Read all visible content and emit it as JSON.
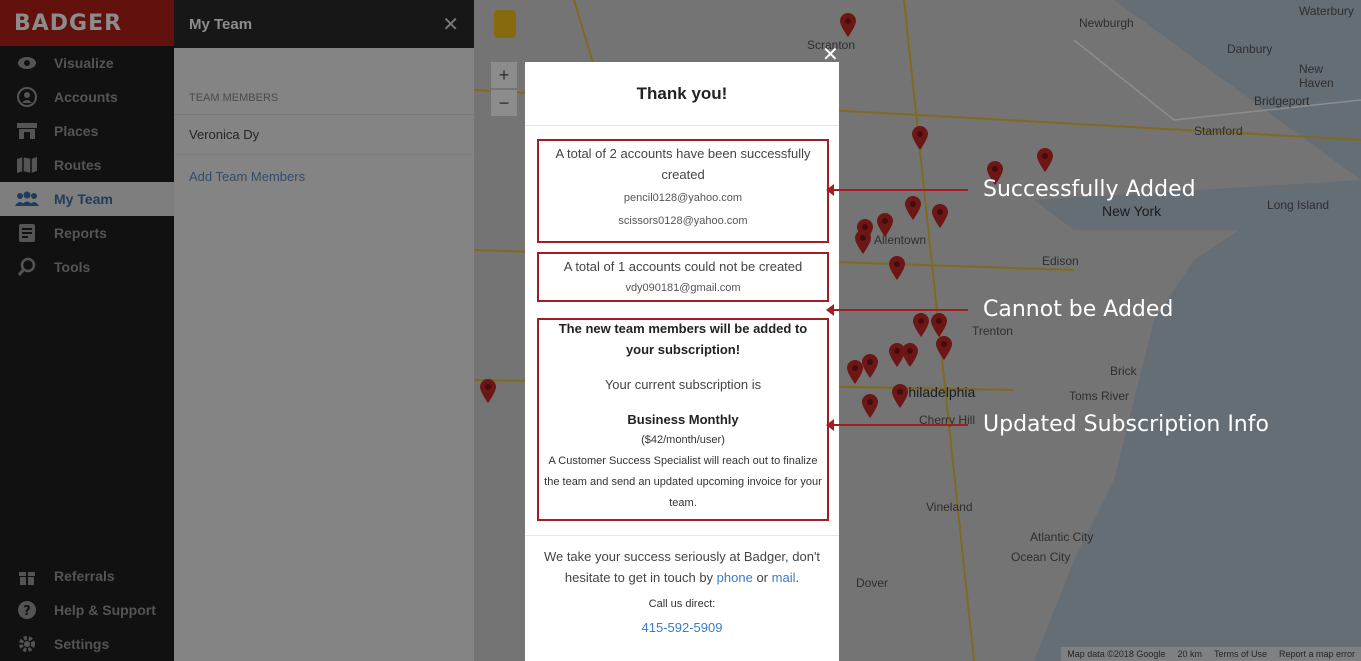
{
  "sidebar": {
    "logo": "BADGER",
    "items": [
      {
        "label": "Visualize",
        "icon": "eye-icon"
      },
      {
        "label": "Accounts",
        "icon": "user-icon"
      },
      {
        "label": "Places",
        "icon": "store-icon"
      },
      {
        "label": "Routes",
        "icon": "map-icon"
      },
      {
        "label": "My Team",
        "icon": "team-icon",
        "active": true
      },
      {
        "label": "Reports",
        "icon": "report-icon"
      },
      {
        "label": "Tools",
        "icon": "tools-icon"
      }
    ],
    "bottom_items": [
      {
        "label": "Referrals",
        "icon": "gift-icon"
      },
      {
        "label": "Help & Support",
        "icon": "help-icon"
      },
      {
        "label": "Settings",
        "icon": "gear-icon"
      }
    ]
  },
  "team_panel": {
    "title": "My Team",
    "section_label": "TEAM MEMBERS",
    "members": [
      "Veronica Dy"
    ],
    "add_link": "Add Team Members"
  },
  "map": {
    "labels": [
      {
        "text": "Scranton"
      },
      {
        "text": "Waterbury"
      },
      {
        "text": "Danbury"
      },
      {
        "text": "New Haven"
      },
      {
        "text": "Bridgeport"
      },
      {
        "text": "Stamford"
      },
      {
        "text": "Newburgh"
      },
      {
        "text": "New York"
      },
      {
        "text": "Long Island"
      },
      {
        "text": "Edison"
      },
      {
        "text": "Trenton"
      },
      {
        "text": "Brick"
      },
      {
        "text": "Toms River"
      },
      {
        "text": "Philadelphia"
      },
      {
        "text": "Cherry Hill"
      },
      {
        "text": "Vineland"
      },
      {
        "text": "Atlantic City"
      },
      {
        "text": "Ocean City"
      },
      {
        "text": "Dover"
      },
      {
        "text": "Allentown"
      }
    ],
    "footer": [
      "Map data ©2018 Google",
      "20 km",
      "Terms of Use",
      "Report a map error"
    ]
  },
  "modal": {
    "title": "Thank you!",
    "success_text": "A total of 2 accounts have been successfully created",
    "success_emails": [
      "pencil0128@yahoo.com",
      "scissors0128@yahoo.com"
    ],
    "fail_text": "A total of 1 accounts could not be created",
    "fail_emails": [
      "vdy090181@gmail.com"
    ],
    "sub_heading": "The new team members will be added to your subscription!",
    "sub_current": "Your current subscription is",
    "sub_plan": "Business Monthly",
    "sub_price": "($42/month/user)",
    "sub_note": "A Customer Success Specialist will reach out to finalize the team and send an updated upcoming invoice for your team.",
    "footer_text_1": "We take your success seriously at Badger, don't hesitate to get in touch by",
    "footer_phone_link": "phone",
    "footer_or": "or",
    "footer_mail_link": "mail",
    "call_label": "Call us direct:",
    "phone_number": "415-592-5909"
  },
  "annotations": [
    "Successfully Added",
    "Cannot be Added",
    "Updated Subscription Info"
  ],
  "colors": {
    "brand_red": "#b21f18",
    "annotation_red": "#a01f24",
    "link_blue": "#3a7dc2",
    "pin_red": "#c62828"
  }
}
